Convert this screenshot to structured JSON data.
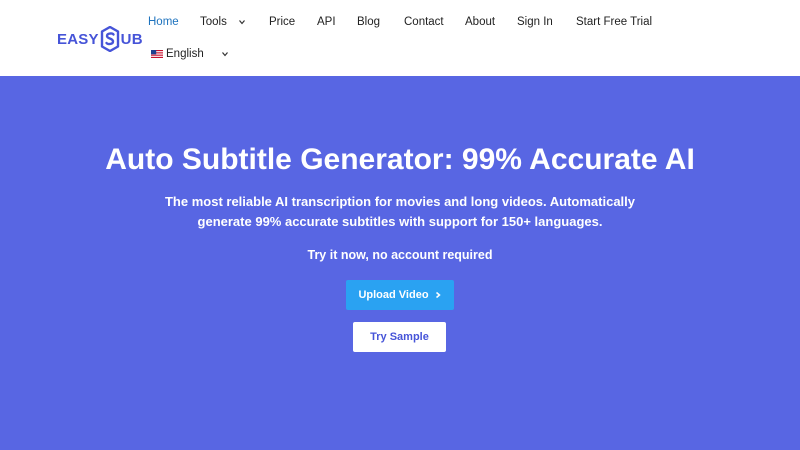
{
  "logo": {
    "text_left": "EASY",
    "text_right": "UB",
    "icon": "s-logo-icon"
  },
  "nav": {
    "items": [
      {
        "label": "Home",
        "active": true
      },
      {
        "label": "Tools",
        "has_dropdown": true
      },
      {
        "label": "Price"
      },
      {
        "label": "API"
      },
      {
        "label": "Blog"
      },
      {
        "label": "Contact"
      },
      {
        "label": "About"
      },
      {
        "label": "Sign In"
      },
      {
        "label": "Start Free Trial"
      }
    ],
    "language": {
      "label": "English",
      "flag_icon": "us-flag-icon",
      "has_dropdown": true
    }
  },
  "hero": {
    "title": "Auto Subtitle Generator: 99% Accurate AI",
    "subtitle": "The most reliable AI transcription for movies and long videos. Automatically generate 99% accurate subtitles with support for 150+ languages.",
    "note": "Try it now, no account required",
    "upload_button": "Upload Video",
    "sample_button": "Try Sample"
  },
  "colors": {
    "hero_background": "#5866e3",
    "upload_button": "#2aa2f2",
    "nav_active": "#1e73be",
    "brand": "#4654d8"
  }
}
